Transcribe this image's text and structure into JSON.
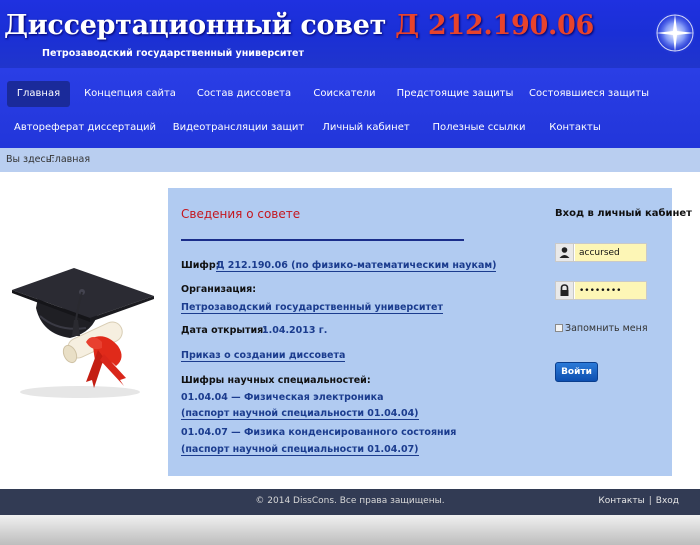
{
  "header": {
    "title_main": "Диссертационный совет ",
    "title_code": "Д 212.190.06",
    "subtitle": "Петрозаводский государственный университет"
  },
  "nav": {
    "row1": [
      "Главная",
      "Концепция сайта",
      "Состав диссовета",
      "Соискатели",
      "Предстоящие защиты",
      "Состоявшиеся защиты"
    ],
    "row2": [
      "Автореферат диссертаций",
      "Видеотрансляции защит",
      "Личный кабинет",
      "Полезные ссылки",
      "Контакты"
    ]
  },
  "breadcrumbs": {
    "prefix": "Вы здесь:",
    "current": "Главная"
  },
  "content": {
    "section_title": "Сведения о совете",
    "cipher_label": "Шифр:",
    "cipher_value": "Д 212.190.06 (по физико-математическим наукам)",
    "org_label": "Организация:",
    "org_value": "Петрозаводский государственный университет",
    "date_label": "Дата открытия:",
    "date_value": "1.04.2013 г.",
    "order_link": "Приказ о создании диссовета",
    "specialties_label": "Шифры научных специальностей:",
    "spec1": "01.04.04 — Физическая электроника",
    "spec1_passport": "(паспорт научной специальности 01.04.04)",
    "spec2": "01.04.07 — Физика конденсированного состояния",
    "spec2_passport": "(паспорт научной специальности 01.04.07)"
  },
  "login": {
    "title": "Вход в личный кабинет",
    "username_value": "accursed",
    "password_value": "••••••••",
    "remember_label": "Запомнить меня",
    "button_label": "Войти"
  },
  "footer": {
    "copyright": "© 2014 DissCons. Все права защищены.",
    "contacts": "Контакты",
    "separator": "|",
    "login": "Вход"
  }
}
